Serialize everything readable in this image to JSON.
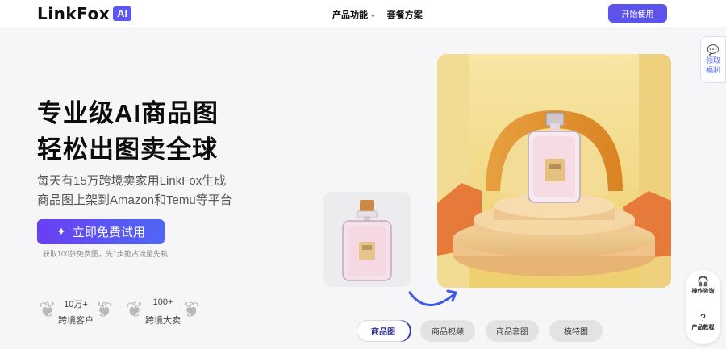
{
  "header": {
    "logo_text": "LinkFox",
    "logo_badge": "AI",
    "nav": [
      {
        "label": "产品功能",
        "has_dropdown": true
      },
      {
        "label": "套餐方案",
        "has_dropdown": false
      }
    ],
    "start_button": "开始使用"
  },
  "hero": {
    "title_line1": "专业级AI商品图",
    "title_line2": "轻松出图卖全球",
    "sub_line1": "每天有15万跨境卖家用LinkFox生成",
    "sub_line2": "商品图上架到Amazon和Temu等平台",
    "cta_label": "立即免费试用",
    "cta_note": "获取100张免费图，先1步抢占流量先机"
  },
  "stats": [
    {
      "value": "10万+",
      "label": "跨境客户"
    },
    {
      "value": "100+",
      "label": "跨境大卖"
    }
  ],
  "tabs": [
    {
      "label": "商品图",
      "active": true
    },
    {
      "label": "商品视频",
      "active": false
    },
    {
      "label": "商品套图",
      "active": false
    },
    {
      "label": "模特图",
      "active": false
    }
  ],
  "side": {
    "welfare_line1": "领取",
    "welfare_line2": "福利",
    "consult_label": "操作咨询",
    "tutorial_label": "产品教程"
  },
  "colors": {
    "accent": "#5b53ec",
    "cta_start": "#6a3ff2",
    "cta_end": "#4f67f4",
    "scene_bg": "#f3dc8c"
  },
  "icons": {
    "cta": "sparkle-icon",
    "welfare": "chat-bubble-icon",
    "consult": "headset-icon",
    "tutorial": "question-icon"
  }
}
